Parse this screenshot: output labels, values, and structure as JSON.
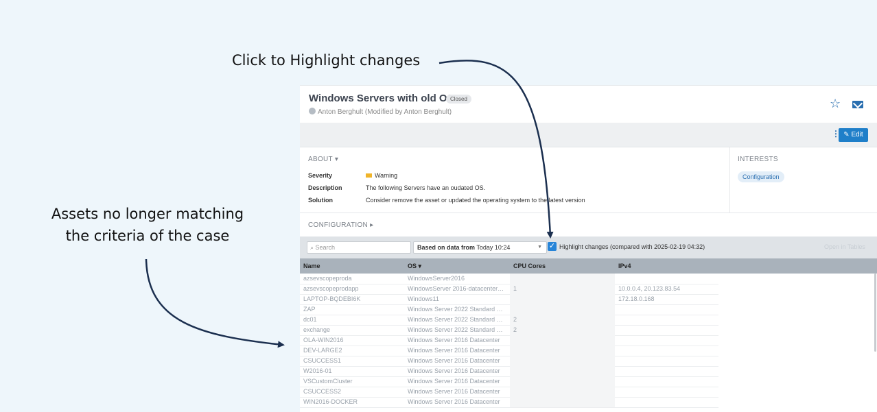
{
  "annotations": {
    "highlight_hint": "Click to Highlight changes",
    "assets_hint_line1": "Assets no longer matching",
    "assets_hint_line2": "the criteria of the case"
  },
  "case": {
    "title": "Windows Servers with old OS",
    "status_badge": "Closed",
    "owner": "Anton Berghult (Modified by Anton Berghult)",
    "edit_label": "Edit",
    "more_icon": "⋮"
  },
  "about": {
    "section_label": "ABOUT ▾",
    "fields": [
      {
        "key": "Severity",
        "value": "Warning"
      },
      {
        "key": "Description",
        "value": "The following Servers have an oudated OS."
      },
      {
        "key": "Solution",
        "value": "Consider remove the asset or updated the operating system to the latest version"
      }
    ]
  },
  "interests": {
    "section_label": "INTERESTS",
    "tag": "Configuration"
  },
  "configuration": {
    "section_label": "CONFIGURATION ▸"
  },
  "filters": {
    "search_placeholder": "Search",
    "date_prefix": "Based on data from",
    "date_value": "Today 10:24",
    "highlight_checked": true,
    "highlight_label": "Highlight changes (compared with 2025-02-19 04:32)",
    "open_in_tables": "Open in Tables"
  },
  "table": {
    "columns": [
      "Name",
      "OS ▾",
      "CPU Cores",
      "IPv4"
    ],
    "rows": [
      [
        "azsevscopeproda",
        "WindowsServer2016",
        "",
        ""
      ],
      [
        "azsevscopeprodapp",
        "WindowsServer 2016-datacenter…",
        "1",
        "10.0.0.4, 20.123.83.54"
      ],
      [
        "LAPTOP-BQDEBI6K",
        "Windows11",
        "",
        "172.18.0.168"
      ],
      [
        "ZAP",
        "Windows Server 2022 Standard …",
        "",
        ""
      ],
      [
        "dc01",
        "Windows Server 2022 Standard …",
        "2",
        ""
      ],
      [
        "exchange",
        "Windows Server 2022 Standard …",
        "2",
        ""
      ],
      [
        "OLA-WIN2016",
        "Windows Server 2016 Datacenter",
        "",
        ""
      ],
      [
        "DEV-LARGE2",
        "Windows Server 2016 Datacenter",
        "",
        ""
      ],
      [
        "CSUCCESS1",
        "Windows Server 2016 Datacenter",
        "",
        ""
      ],
      [
        "W2016-01",
        "Windows Server 2016 Datacenter",
        "",
        ""
      ],
      [
        "VSCustomCluster",
        "Windows Server 2016 Datacenter",
        "",
        ""
      ],
      [
        "CSUCCESS2",
        "Windows Server 2016 Datacenter",
        "",
        ""
      ],
      [
        "WIN2016-DOCKER",
        "Windows Server 2016 Datacenter",
        "",
        ""
      ]
    ]
  },
  "colors": {
    "accent": "#1f7fc9",
    "arrow": "#1b2f4f",
    "warning": "#f0b429",
    "background": "#eef6fb"
  }
}
